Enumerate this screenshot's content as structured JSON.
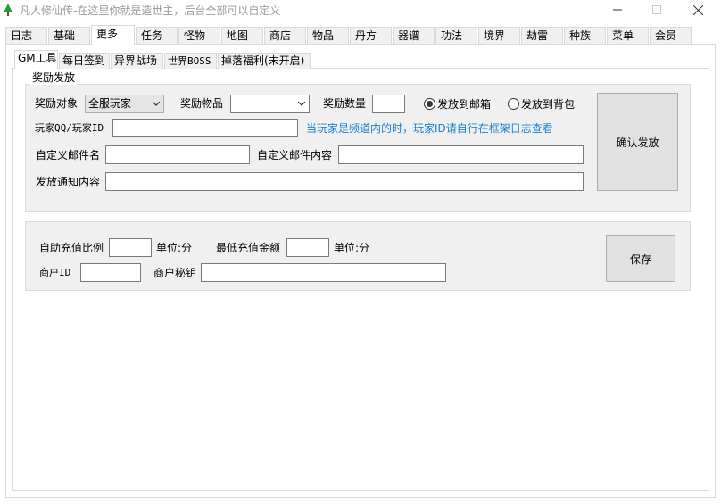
{
  "window": {
    "title": "凡人修仙传-在这里你就是造世主，后台全部可以自定义",
    "controls": {
      "minimize": "—",
      "maximize": "☐",
      "close": "✕"
    },
    "icon": "tree-icon"
  },
  "main_tabs": [
    "日志",
    "基础",
    "更多",
    "任务",
    "怪物",
    "地图",
    "商店",
    "物品",
    "丹方",
    "器谱",
    "功法",
    "境界",
    "劫雷",
    "种族",
    "菜单",
    "会员"
  ],
  "main_tabs_active": "更多",
  "sub_tabs": [
    "GM工具",
    "每日签到",
    "异界战场",
    "世界BOSS",
    "掉落福利(未开启)"
  ],
  "sub_tabs_active": "GM工具",
  "reward": {
    "legend": "奖励发放",
    "target_label": "奖励对象",
    "target_value": "全服玩家",
    "item_label": "奖励物品",
    "item_value": "",
    "quantity_label": "奖励数量",
    "quantity_value": "",
    "radio_mailbox": "发放到邮箱",
    "radio_mailbox_checked": true,
    "radio_backpack": "发放到背包",
    "radio_backpack_checked": false,
    "player_id_label": "玩家QQ/玩家ID",
    "player_id_value": "",
    "hint": "当玩家是频道内的时，玩家ID请自行在框架日志查看",
    "mail_name_label": "自定义邮件名",
    "mail_name_value": "",
    "mail_content_label": "自定义邮件内容",
    "mail_content_value": "",
    "notice_label": "发放通知内容",
    "notice_value": "",
    "confirm_button": "确认发放"
  },
  "recharge": {
    "ratio_label": "自助充值比例",
    "ratio_value": "",
    "ratio_unit": "单位:分",
    "min_label": "最低充值金额",
    "min_value": "",
    "min_unit": "单位:分",
    "merchant_id_label": "商户ID",
    "merchant_id_value": "",
    "merchant_key_label": "商户秘钥",
    "merchant_key_value": "",
    "save_button": "保存"
  },
  "colors": {
    "hint": "#1a7fd4",
    "group_bg": "#f0f0f0",
    "title_text": "#9a9a9a"
  }
}
